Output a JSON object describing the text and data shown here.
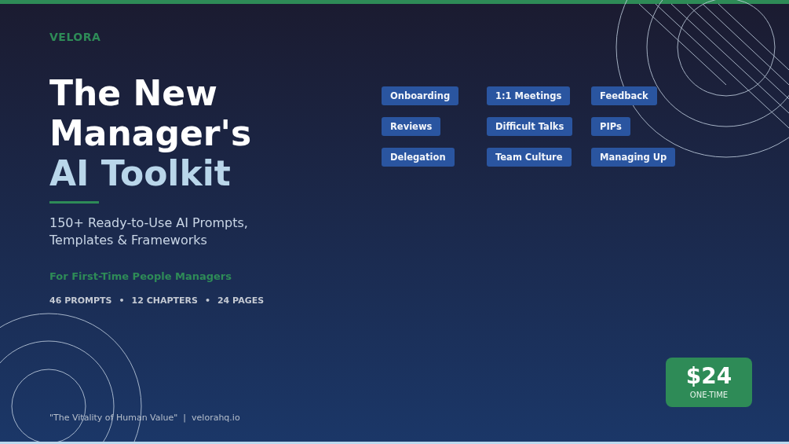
{
  "brand": "VELORA",
  "title_lines": [
    {
      "text": "The New",
      "accent": false
    },
    {
      "text": "Manager's",
      "accent": false
    },
    {
      "text": "AI Toolkit",
      "accent": true
    }
  ],
  "subtitle_lines": [
    "150+ Ready-to-Use AI Prompts,",
    "Templates & Frameworks"
  ],
  "audience": "For First-Time People Managers",
  "stats": [
    "46 PROMPTS",
    "•",
    "12 CHAPTERS",
    "•",
    "24 PAGES"
  ],
  "footer": "\"The Vitality of Human Value\"  |  velorahq.io",
  "tags": [
    "Onboarding",
    "1:1 Meetings",
    "Feedback",
    "Reviews",
    "Difficult Talks",
    "PIPs",
    "Delegation",
    "Team Culture",
    "Managing Up"
  ],
  "price": {
    "amount": "$24",
    "note": "ONE-TIME"
  }
}
